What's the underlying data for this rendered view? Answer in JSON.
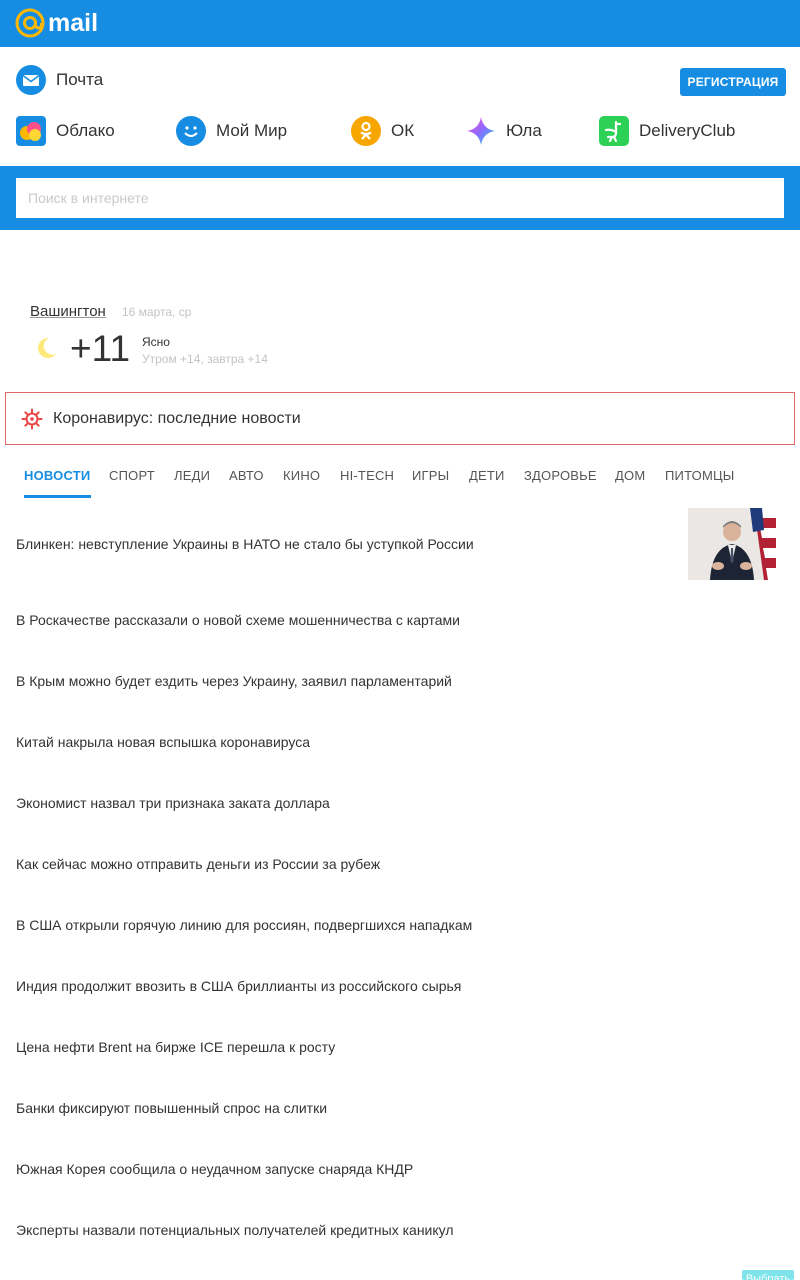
{
  "header": {
    "logo_text": "mail"
  },
  "services": {
    "mail_label": "Почта",
    "register_label": "РЕГИСТРАЦИЯ",
    "items": [
      {
        "label": "Облако",
        "icon": "cloud-icon"
      },
      {
        "label": "Мой Мир",
        "icon": "my-world-icon"
      },
      {
        "label": "ОК",
        "icon": "odnoklassniki-icon"
      },
      {
        "label": "Юла",
        "icon": "youla-icon"
      },
      {
        "label": "DeliveryClub",
        "icon": "delivery-club-icon"
      }
    ]
  },
  "search": {
    "placeholder": "Поиск в интернете"
  },
  "weather": {
    "city": "Вашингтон",
    "date": "16 марта, ср",
    "temp": "+11",
    "condition": "Ясно",
    "forecast": "Утром +14, завтра +14"
  },
  "covid": {
    "label": "Коронавирус: последние новости"
  },
  "tabs": [
    "НОВОСТИ",
    "СПОРТ",
    "ЛЕДИ",
    "АВТО",
    "КИНО",
    "HI-TECH",
    "ИГРЫ",
    "ДЕТИ",
    "ЗДОРОВЬЕ",
    "ДОМ",
    "ПИТОМЦЫ"
  ],
  "news": [
    "Блинкен: невступление Украины в НАТО не стало бы уступкой России",
    "В Роскачестве рассказали о новой схеме мошенничества с картами",
    "В Крым можно будет ездить через Украину, заявил парламентарий",
    "Китай накрыла новая вспышка коронавируса",
    "Экономист назвал три признака заката доллара",
    "Как сейчас можно отправить деньги из России за рубеж",
    "В США открыли горячую линию для россиян, подвергшихся нападкам",
    "Индия продолжит ввозить в США бриллианты из российского сырья",
    "Цена нефти Brent на бирже ICE перешла к росту",
    "Банки фиксируют повышенный спрос на слитки",
    "Южная Корея сообщила о неудачном запуске снаряда КНДР",
    "Эксперты назвали потенциальных получателей кредитных каникул"
  ],
  "corner_button": "Выбрать"
}
